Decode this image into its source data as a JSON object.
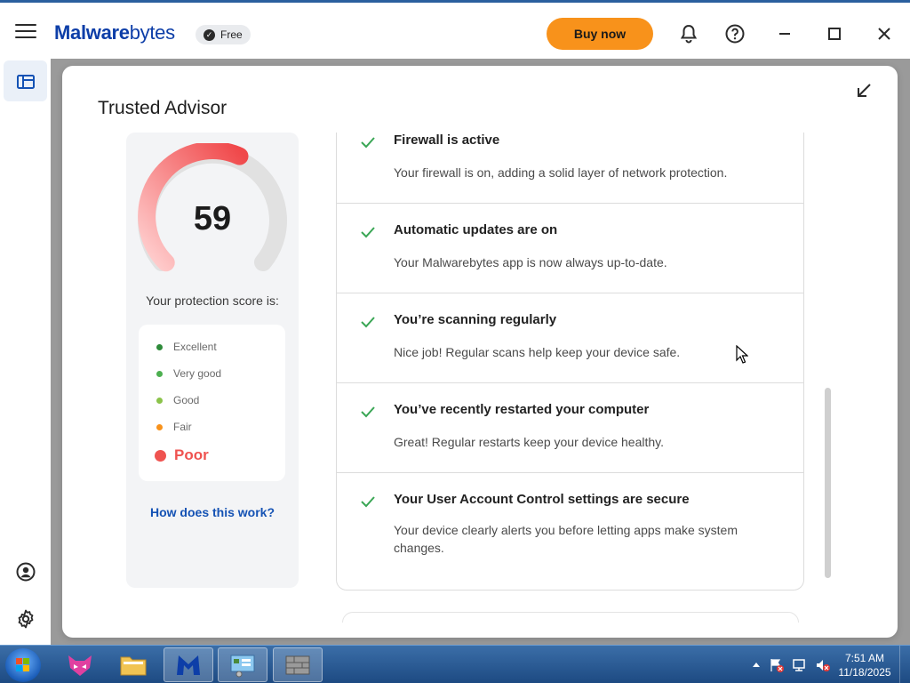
{
  "app": {
    "brand_prefix": "Malware",
    "brand_suffix": "bytes",
    "plan_badge": "Free",
    "buy_label": "Buy now",
    "colors": {
      "brand": "#0d3ea8",
      "buy": "#f8921b",
      "check": "#3aa655",
      "poor": "#ef5350"
    }
  },
  "panel": {
    "title": "Trusted Advisor",
    "score": "59",
    "score_label": "Your protection score is:",
    "score_fraction": 0.59,
    "legend": [
      {
        "label": "Excellent",
        "color": "#2e8b3a"
      },
      {
        "label": "Very good",
        "color": "#4caf50"
      },
      {
        "label": "Good",
        "color": "#8bc34a"
      },
      {
        "label": "Fair",
        "color": "#f8921b"
      },
      {
        "label": "Poor",
        "color": "#ef5350"
      }
    ],
    "how_link": "How does this work?"
  },
  "checks": [
    {
      "title": "Firewall is active",
      "desc": "Your firewall is on, adding a solid layer of network protection."
    },
    {
      "title": "Automatic updates are on",
      "desc": "Your Malwarebytes app is now always up-to-date."
    },
    {
      "title": "You’re scanning regularly",
      "desc": "Nice job! Regular scans help keep your device safe."
    },
    {
      "title": "You’ve recently restarted your computer",
      "desc": "Great! Regular restarts keep your device healthy."
    },
    {
      "title": "Your User Account Control settings are secure",
      "desc": "Your device clearly alerts you before letting apps make system changes."
    }
  ],
  "taskbar": {
    "time": "7:51 AM",
    "date": "11/18/2025"
  }
}
